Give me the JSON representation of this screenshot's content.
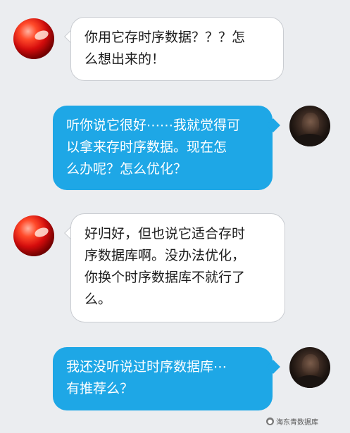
{
  "chat": {
    "messages": [
      {
        "side": "left",
        "text": "你用它存时序数据？？？怎\n么想出来的！"
      },
      {
        "side": "right",
        "text": "听你说它很好⋯⋯我就觉得可\n以拿来存时序数据。现在怎\n么办呢？怎么优化？"
      },
      {
        "side": "left",
        "text": "好归好，但也说它适合存时\n序数据库啊。没办法优化，\n你换个时序数据库不就行了\n么。"
      },
      {
        "side": "right",
        "text": "我还没听说过时序数据库⋯\n有推荐么？"
      }
    ]
  },
  "watermark": {
    "icon": "wechat-icon",
    "text": "海东青数据库"
  },
  "colors": {
    "background": "#ebedf0",
    "bubble_left": "#ffffff",
    "bubble_right": "#1ea7e6"
  }
}
